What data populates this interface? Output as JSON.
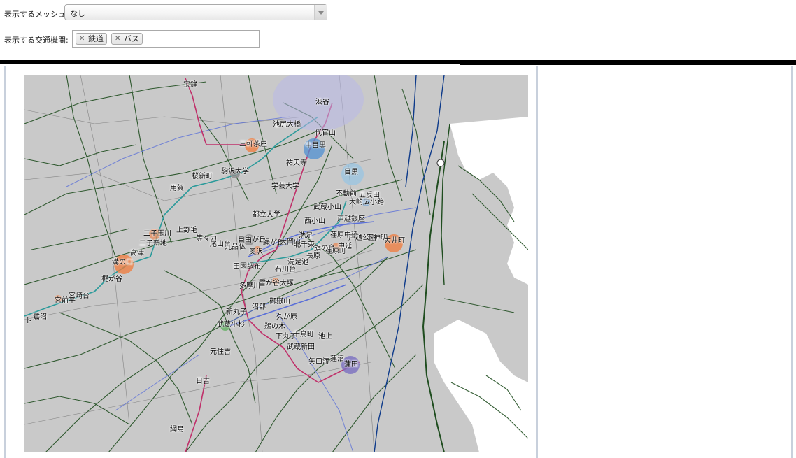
{
  "controls": {
    "mesh_label": "表示するメッシュ:",
    "mesh_value": "なし",
    "transport_label": "表示する交通機関:",
    "chips": [
      {
        "label": "鉄道"
      },
      {
        "label": "バス"
      }
    ]
  },
  "colors": {
    "map_background": "#c9c9c9",
    "sea": "#ffffff",
    "road": "#1f4d1f",
    "rail_red": "#c0306a",
    "rail_teal": "#2a9a9a",
    "rail_blue": "#5a6fd8",
    "marker_orange": "#f07a3a",
    "marker_blue": "#4f8fd0",
    "marker_lightblue": "#8ec4ea",
    "marker_purple": "#7a6fc0",
    "marker_gray": "#8a8a8a"
  },
  "map": {
    "stations": [
      {
        "name": "渋谷"
      },
      {
        "name": "池尻大橋"
      },
      {
        "name": "代官山"
      },
      {
        "name": "三軒茶屋"
      },
      {
        "name": "中目黒"
      },
      {
        "name": "祐天寺"
      },
      {
        "name": "目黒"
      },
      {
        "name": "駒沢大学"
      },
      {
        "name": "桜新町"
      },
      {
        "name": "用賀"
      },
      {
        "name": "学芸大学"
      },
      {
        "name": "不動前"
      },
      {
        "name": "五反田"
      },
      {
        "name": "大崎広小路"
      },
      {
        "name": "武蔵小山"
      },
      {
        "name": "都立大学"
      },
      {
        "name": "西小山"
      },
      {
        "name": "戸越銀座"
      },
      {
        "name": "二子玉川"
      },
      {
        "name": "上野毛"
      },
      {
        "name": "二子新地"
      },
      {
        "name": "等々力"
      },
      {
        "name": "尾山台"
      },
      {
        "name": "九品仏"
      },
      {
        "name": "自由が丘"
      },
      {
        "name": "緑が丘"
      },
      {
        "name": "大岡山"
      },
      {
        "name": "洗足"
      },
      {
        "name": "北千束"
      },
      {
        "name": "旗の台"
      },
      {
        "name": "荏原中延"
      },
      {
        "name": "戸越公園"
      },
      {
        "name": "中延"
      },
      {
        "name": "荏原町"
      },
      {
        "name": "下神明"
      },
      {
        "name": "大井町"
      },
      {
        "name": "高津"
      },
      {
        "name": "溝の口"
      },
      {
        "name": "奥沢"
      },
      {
        "name": "長原"
      },
      {
        "name": "田園調布"
      },
      {
        "name": "洗足池"
      },
      {
        "name": "石川台"
      },
      {
        "name": "梶が谷"
      },
      {
        "name": "多摩川"
      },
      {
        "name": "雪が谷大塚"
      },
      {
        "name": "宮崎台"
      },
      {
        "name": "宮前平"
      },
      {
        "name": "御嶽山"
      },
      {
        "name": "沼部"
      },
      {
        "name": "新丸子"
      },
      {
        "name": "鷺沼"
      },
      {
        "name": "久が原"
      },
      {
        "name": "武蔵小杉"
      },
      {
        "name": "鵜の木"
      },
      {
        "name": "下丸子"
      },
      {
        "name": "千鳥町"
      },
      {
        "name": "池上"
      },
      {
        "name": "武蔵新田"
      },
      {
        "name": "元住吉"
      },
      {
        "name": "矢口渡"
      },
      {
        "name": "蓮沼"
      },
      {
        "name": "蒲田"
      },
      {
        "name": "日吉"
      },
      {
        "name": "綱島"
      },
      {
        "name": "ト"
      }
    ],
    "top_label": "宝鉾"
  }
}
